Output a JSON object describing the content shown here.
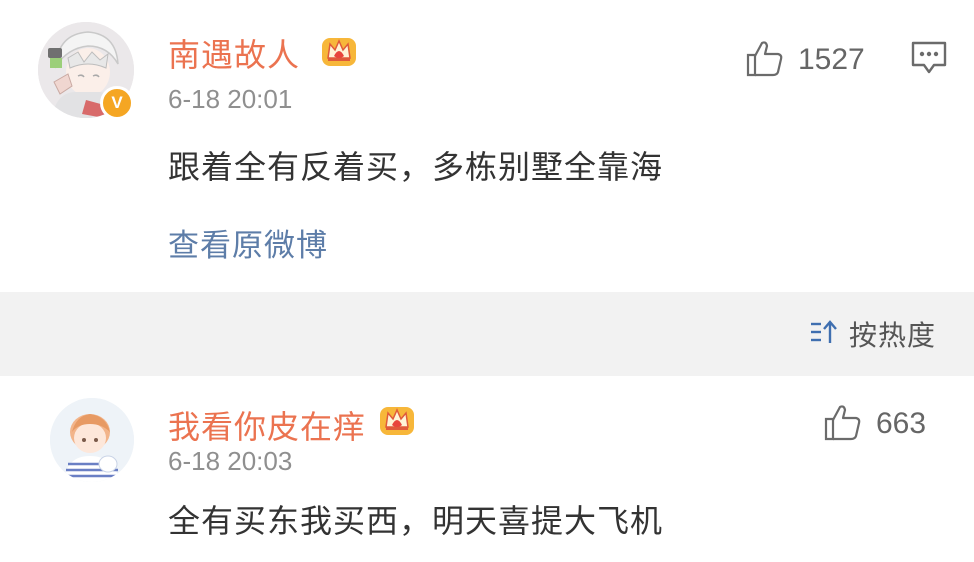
{
  "comments": [
    {
      "username": "南遇故人",
      "time": "6-18 20:01",
      "text": "跟着全有反着买，多栋别墅全靠海",
      "likes": "1527",
      "view_link": "查看原微博",
      "verified_badge": "V"
    },
    {
      "username": "我看你皮在痒",
      "time": "6-18 20:03",
      "text": "全有买东我买西，明天喜提大飞机",
      "likes": "663"
    }
  ],
  "sort": {
    "label": "按热度"
  },
  "colors": {
    "username": "#eb7350",
    "link": "#5d7da8",
    "text": "#333333",
    "meta": "#8f8f8f",
    "badge": "#f5a623"
  },
  "icons": {
    "like": "thumbs-up-icon",
    "reply": "comment-icon",
    "sort": "sort-icon",
    "crown": "crown-badge-icon"
  }
}
